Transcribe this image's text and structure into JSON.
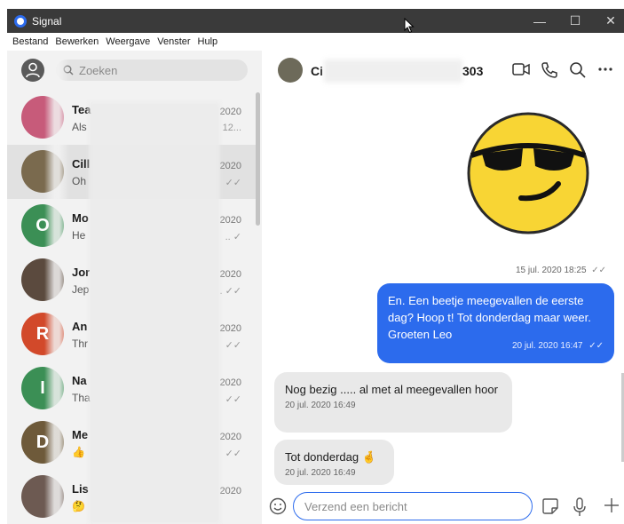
{
  "window": {
    "title": "Signal",
    "min": "—",
    "max": "☐",
    "close": "✕"
  },
  "menu": [
    "Bestand",
    "Bewerken",
    "Weergave",
    "Venster",
    "Hulp"
  ],
  "search": {
    "placeholder": "Zoeken"
  },
  "conversations": [
    {
      "name": "Tea",
      "snippet": "Als",
      "date": "2020",
      "meta": "12...",
      "avatar_color": "#c75b7a"
    },
    {
      "name": "Cill",
      "snippet": "Oh",
      "date": "2020",
      "meta": "✓✓",
      "avatar_color": "#7a6a4e",
      "selected": true
    },
    {
      "name": "Mo",
      "snippet": "He",
      "date": "2020",
      "meta": ".. ✓",
      "avatar_color": "#3b8f55",
      "initial": "O"
    },
    {
      "name": "Jor",
      "snippet": "Jep",
      "date": "2020",
      "meta": ". ✓✓",
      "avatar_color": "#5b4a3e"
    },
    {
      "name": "An",
      "snippet": "Thr",
      "date": "2020",
      "meta": "✓✓",
      "avatar_color": "#d2492a",
      "initial": "R"
    },
    {
      "name": "Na",
      "snippet": "Tha",
      "date": "2020",
      "meta": "✓✓",
      "avatar_color": "#3b8f55",
      "initial": "I"
    },
    {
      "name": "Me",
      "snippet": "👍",
      "date": "2020",
      "meta": "✓✓",
      "avatar_color": "#6e5a3a",
      "initial": "D"
    },
    {
      "name": "Lis",
      "snippet": "🤔",
      "date": "2020",
      "meta": "",
      "avatar_color": "#6d5a52"
    }
  ],
  "chat": {
    "name_prefix": "Ci",
    "name_suffix": "303",
    "sticker_timestamp": "15 jul. 2020 18:25",
    "messages_out": [
      {
        "text": "En. Een beetje meegevallen de eerste dag? Hoop t! Tot donderdag maar weer. Groeten Leo",
        "time": "20 jul. 2020 16:47"
      }
    ],
    "messages_in": [
      {
        "text": "Nog bezig ..... al met al meegevallen hoor",
        "time": "20 jul. 2020 16:49"
      },
      {
        "text": "Tot donderdag 🤞",
        "time": "20 jul. 2020 16:49"
      }
    ]
  },
  "composer": {
    "placeholder": "Verzend een bericht"
  },
  "colors": {
    "accent": "#2c6bed",
    "titlebar": "#3a3a3a",
    "sidebar": "#f2f2f2"
  },
  "icons": [
    "signal-logo-icon",
    "search-icon",
    "avatar-placeholder-icon",
    "video-call-icon",
    "phone-icon",
    "chat-search-icon",
    "more-icon",
    "emoji-icon",
    "sticker-icon",
    "microphone-icon",
    "plus-icon"
  ]
}
